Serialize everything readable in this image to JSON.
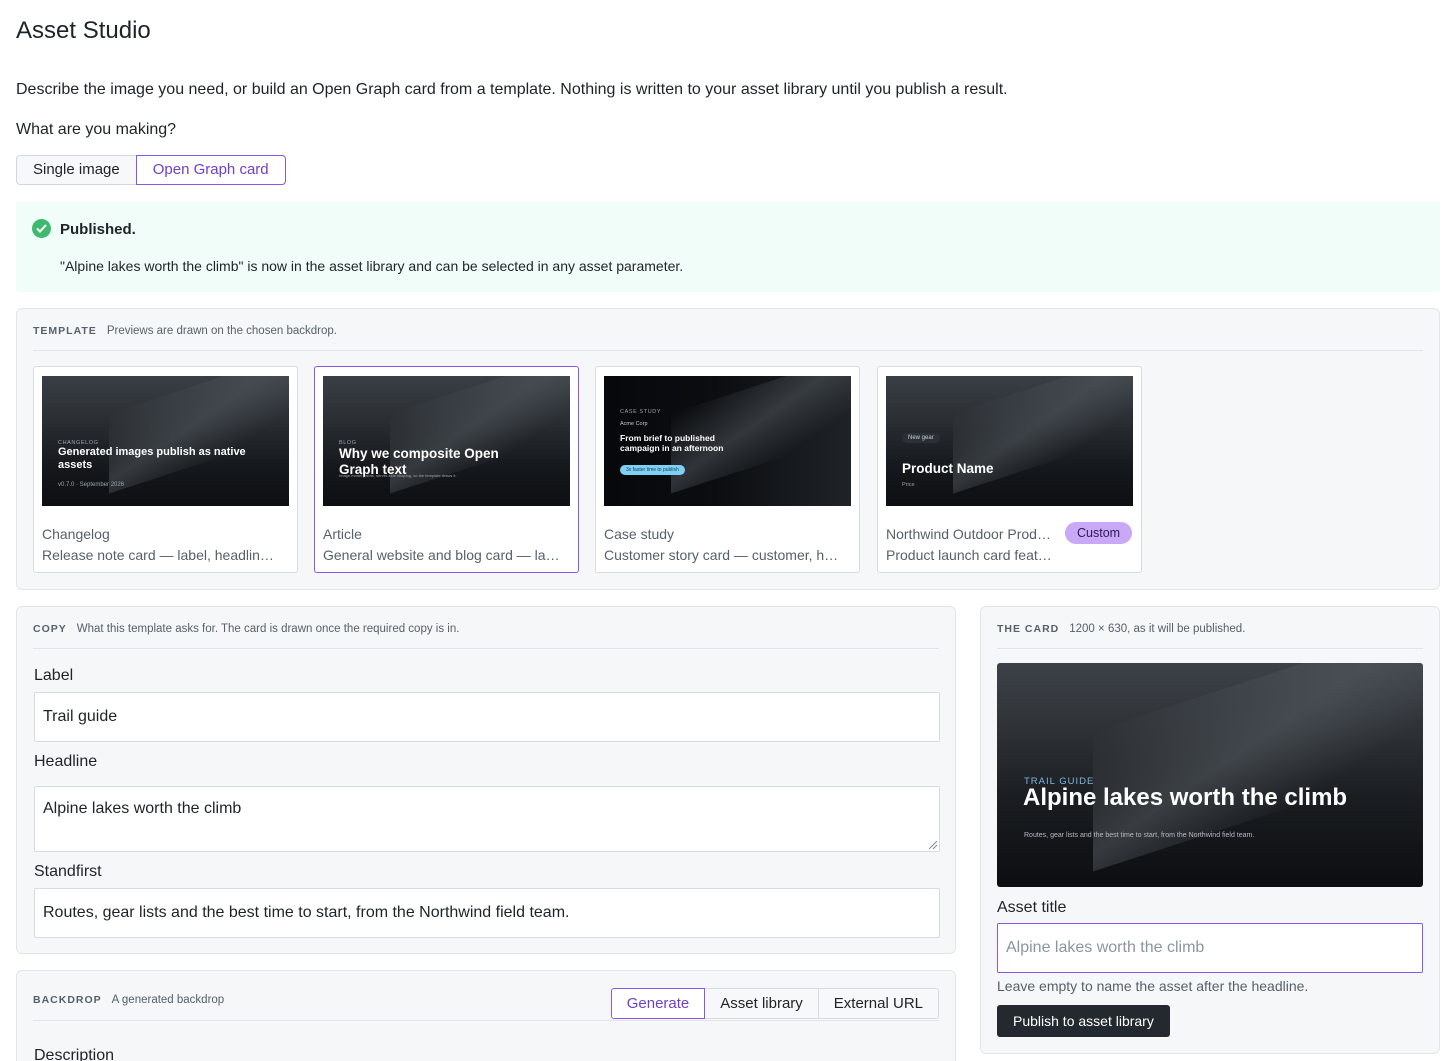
{
  "app": {
    "title": "Asset Studio",
    "intro": "Describe the image you need, or build an Open Graph card from a template. Nothing is written to your asset library until you publish a result.",
    "question": "What are you making?"
  },
  "mode": {
    "options": [
      "Single image",
      "Open Graph card"
    ],
    "selected": "Open Graph card"
  },
  "notice": {
    "title": "Published.",
    "message": "\"Alpine lakes worth the climb\" is now in the asset library and can be selected in any asset parameter.",
    "accent": "#3fb970"
  },
  "template_panel": {
    "eyebrow": "TEMPLATE",
    "subtitle": "Previews are drawn on the chosen backdrop.",
    "selected": "Article",
    "cards": [
      {
        "name": "Changelog",
        "description": "Release note card — label, headlin…",
        "thumb": {
          "label": "CHANGELOG",
          "headline": "Generated images publish as native assets",
          "meta": "v0.7.0 · September 2026"
        }
      },
      {
        "name": "Article",
        "description": "General website and blog card — la…",
        "thumb": {
          "label": "BLOG",
          "headline": "Why we composite Open Graph text",
          "meta": "Image model paints, server-side shaping, so the template draws it."
        }
      },
      {
        "name": "Case study",
        "description": "Customer story card — customer, h…",
        "thumb": {
          "label": "CASE STUDY",
          "customer": "Acme Corp",
          "headline": "From brief to published campaign in an afternoon",
          "pill": "3x faster time to publish"
        }
      },
      {
        "name": "Northwind Outdoor Prod…",
        "description": "Product launch card feat…",
        "badge": "Custom",
        "thumb": {
          "chip": "New gear",
          "headline": "Product Name",
          "meta": "Price"
        }
      }
    ]
  },
  "copy_panel": {
    "eyebrow": "COPY",
    "subtitle": "What this template asks for. The card is drawn once the required copy is in.",
    "fields": {
      "label": {
        "label": "Label",
        "value": "Trail guide"
      },
      "headline": {
        "label": "Headline",
        "value": "Alpine lakes worth the climb"
      },
      "standfirst": {
        "label": "Standfirst",
        "value": "Routes, gear lists and the best time to start, from the Northwind field team."
      }
    }
  },
  "backdrop_panel": {
    "eyebrow": "BACKDROP",
    "subtitle": "A generated backdrop",
    "tabs": [
      "Generate",
      "Asset library",
      "External URL"
    ],
    "selected": "Generate",
    "description_label": "Description"
  },
  "card_panel": {
    "eyebrow": "THE CARD",
    "subtitle": "1200 × 630, as it will be published.",
    "preview": {
      "label": "TRAIL GUIDE",
      "headline": "Alpine lakes worth the climb",
      "standfirst": "Routes, gear lists and the best time to start, from the Northwind field team."
    },
    "asset_title_label": "Asset title",
    "asset_title_placeholder": "Alpine lakes worth the climb",
    "hint": "Leave empty to name the asset after the headline.",
    "publish_label": "Publish to asset library"
  },
  "colors": {
    "accent": "#8957e5",
    "badge": "#c9a8f7",
    "success_bg": "#f0fdf8",
    "primary_button": "#24292f"
  }
}
